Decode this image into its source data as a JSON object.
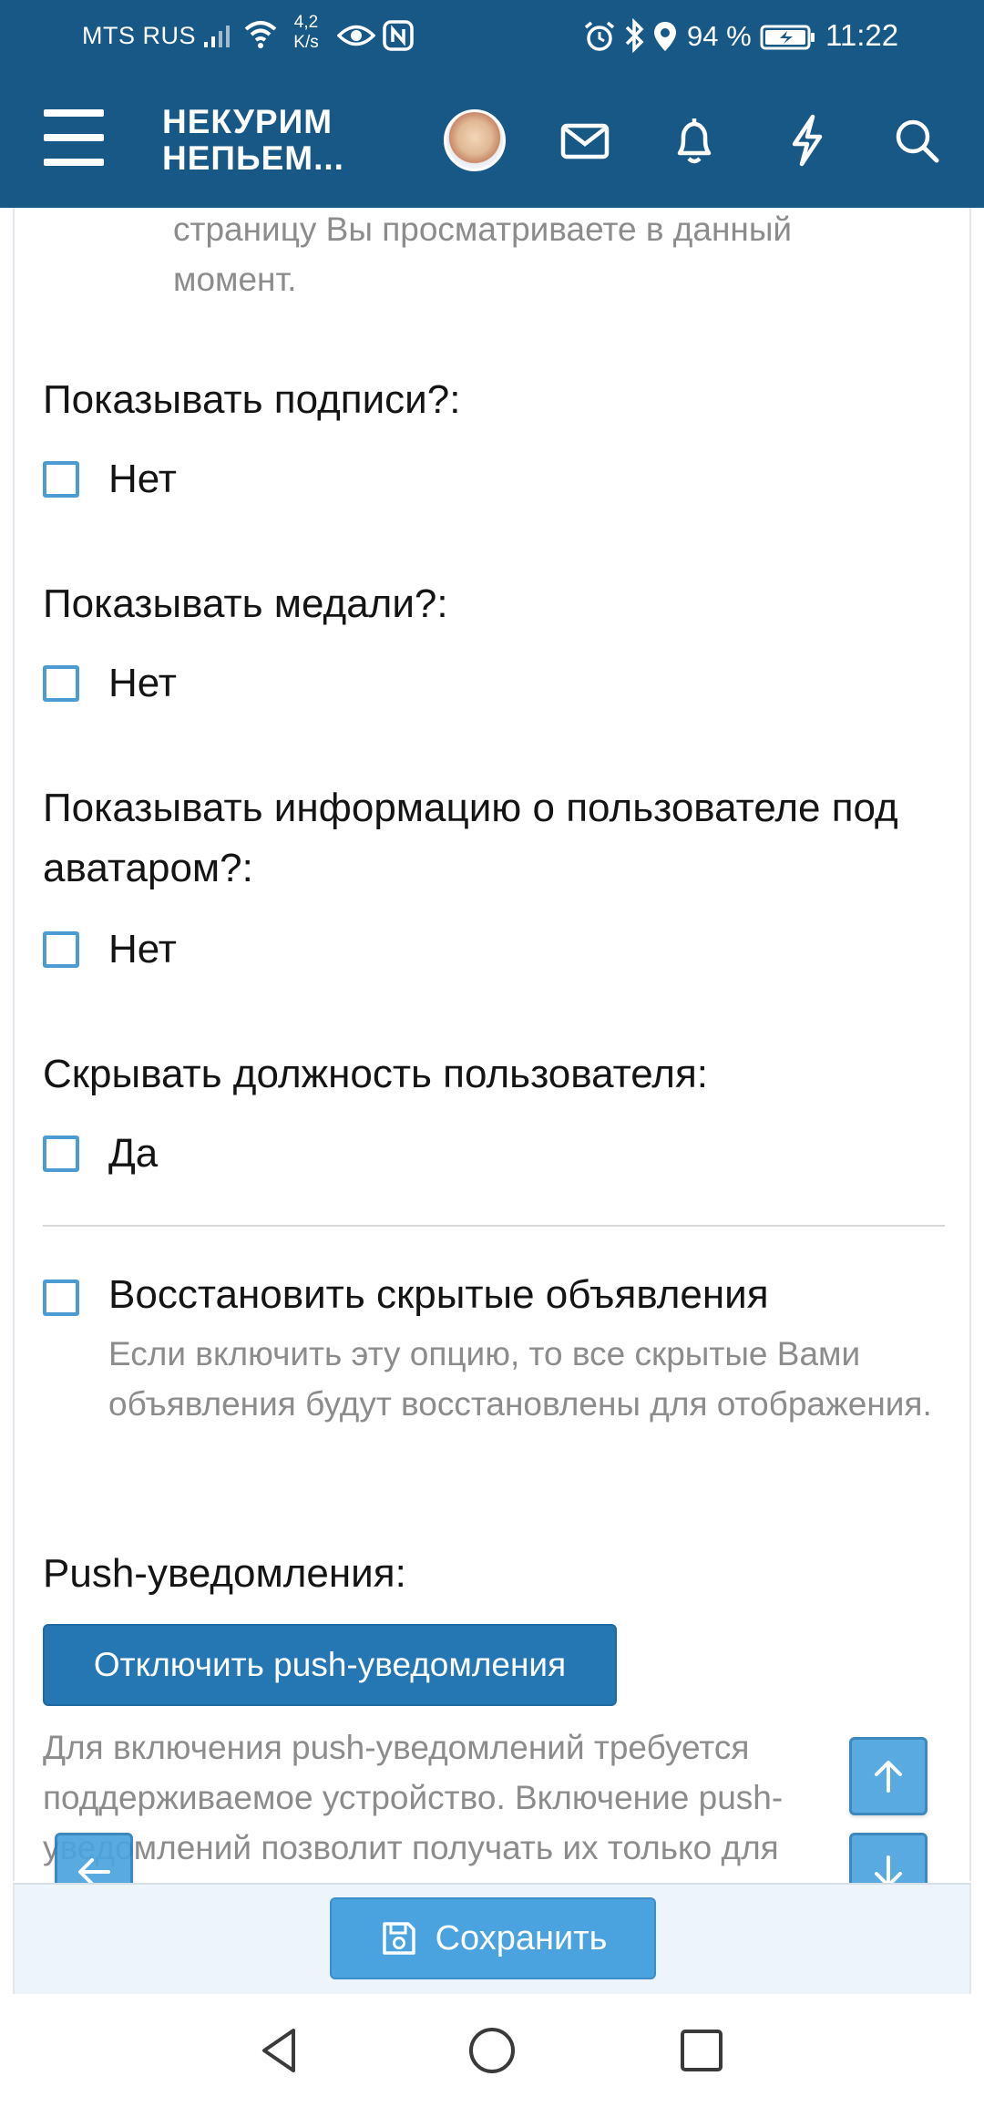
{
  "status_bar": {
    "carrier": "MTS RUS",
    "net_speed_value": "4,2",
    "net_speed_unit": "K/s",
    "battery_percent": "94 %",
    "time": "11:22"
  },
  "nav": {
    "brand_line1": "НЕКУРИМ",
    "brand_line2": "НЕПЬЕМ..."
  },
  "content": {
    "continued_text": "страницу Вы просматриваете в данный момент.",
    "settings": [
      {
        "question": "Показывать подписи?:",
        "option": "Нет"
      },
      {
        "question": "Показывать медали?:",
        "option": "Нет"
      },
      {
        "question": "Показывать информацию о пользователе под аватаром?:",
        "option": "Нет"
      },
      {
        "question": "Скрывать должность пользователя:",
        "option": "Да"
      }
    ],
    "restore": {
      "title": "Восстановить скрытые объявления",
      "description": "Если включить эту опцию, то все скрытые Вами объявления будут восстановлены для отображения."
    },
    "push": {
      "label": "Push-уведомления:",
      "button": "Отключить push-уведомления",
      "description": "Для включения push-уведомлений требуется поддерживаемое устройство. Включение push-уведомлений позволит получать их только для"
    }
  },
  "save_bar": {
    "save_label": "Сохранить"
  },
  "colors": {
    "header_bg": "#185886",
    "checkbox_border": "#4c9bd2",
    "push_button_bg": "#2577b3",
    "save_button_bg": "#4aa3df",
    "muted_text": "#8c8c8c"
  },
  "icons": [
    "menu-icon",
    "mail-icon",
    "bell-icon",
    "bolt-icon",
    "search-icon",
    "arrow-left-icon",
    "arrow-up-icon",
    "arrow-down-icon",
    "floppy-disk-icon",
    "back-triangle-icon",
    "home-circle-icon",
    "recents-square-icon"
  ]
}
